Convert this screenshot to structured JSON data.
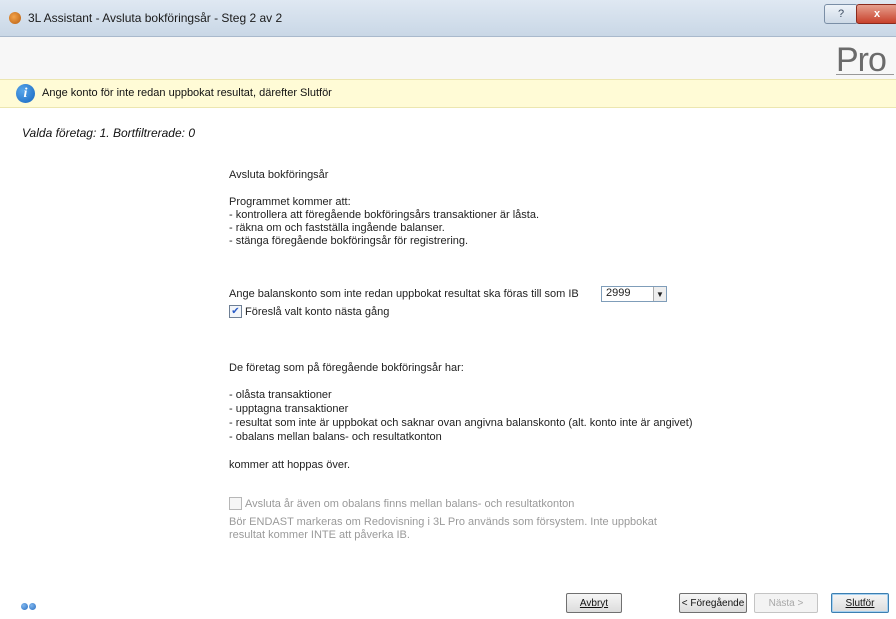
{
  "window": {
    "title": "3L Assistant - Avsluta bokföringsår - Steg 2 av 2",
    "help_label": "?",
    "close_label": "x"
  },
  "brand": {
    "logo_text": "Pro"
  },
  "info_bar": {
    "message": "Ange konto för inte redan uppbokat resultat, därefter Slutför"
  },
  "selection_status": "Valda företag: 1. Bortfiltrerade: 0",
  "content": {
    "heading": "Avsluta bokföringsår",
    "intro": "Programmet kommer att:",
    "steps": [
      " - kontrollera att föregående bokföringsårs transaktioner är låsta.",
      " - räkna om och fastställa ingående balanser.",
      " - stänga föregående bokföringsår för registrering."
    ],
    "account_prompt": "Ange balanskonto som inte redan uppbokat resultat ska föras till som IB",
    "account_value": "2999",
    "suggest_checkbox_label": "Föreslå valt konto nästa gång",
    "suggest_checked": true,
    "skip_intro": "De företag som på föregående bokföringsår har:",
    "skip_reasons": [
      "- olåsta transaktioner",
      "- upptagna transaktioner",
      "- resultat som inte är uppbokat och saknar ovan angivna balanskonto (alt. konto inte är angivet)",
      "- obalans mellan balans- och resultatkonton"
    ],
    "skip_outro": "kommer att hoppas över.",
    "imbalance_checkbox_label": "Avsluta år även om obalans finns mellan balans- och resultatkonton",
    "imbalance_checked": false,
    "imbalance_note_line1": "Bör ENDAST markeras om Redovisning i 3L Pro används som försystem. Inte uppbokat",
    "imbalance_note_line2": "resultat kommer INTE att påverka IB."
  },
  "buttons": {
    "cancel": "Avbryt",
    "previous": "< Föregående",
    "next": "Nästa >",
    "finish": "Slutför"
  }
}
